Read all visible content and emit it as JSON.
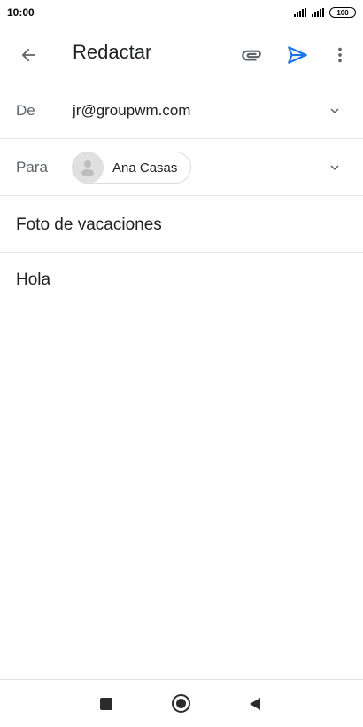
{
  "status_bar": {
    "time": "10:00",
    "battery": "100"
  },
  "app_bar": {
    "title": "Redactar",
    "icons": [
      "back-arrow-icon",
      "attachment-icon",
      "send-icon",
      "more-vert-icon"
    ],
    "accent_color": "#1a73e8"
  },
  "from_row": {
    "label": "De",
    "value": "jr@groupwm.com"
  },
  "to_row": {
    "label": "Para",
    "recipient_name": "Ana Casas"
  },
  "subject": "Foto de vacaciones",
  "body": "Hola"
}
